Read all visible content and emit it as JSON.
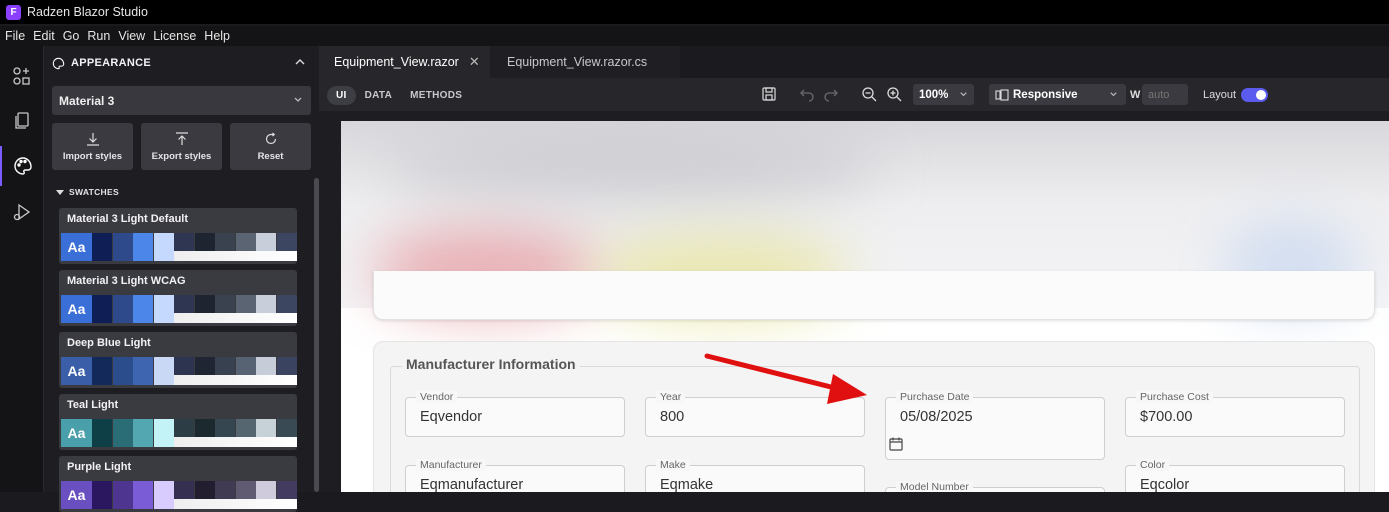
{
  "app": {
    "title": "Radzen Blazor Studio"
  },
  "menu": [
    "File",
    "Edit",
    "Go",
    "Run",
    "View",
    "License",
    "Help"
  ],
  "activity": [
    "components-icon",
    "files-icon",
    "palette-icon",
    "run-debug-icon"
  ],
  "panel": {
    "title": "APPEARANCE",
    "theme": "Material 3",
    "buttons": {
      "import": "Import styles",
      "export": "Export styles",
      "reset": "Reset"
    },
    "swatches_title": "SWATCHES",
    "swatches": [
      {
        "name": "Material 3 Light Default",
        "aa": "Aa",
        "aa_color": "#3b6fd8",
        "colors": [
          "#0f1f55",
          "#2e4a8a",
          "#4c86e8",
          "#c5d9ff",
          "#2f3652",
          "#1e2530",
          "#3a4250",
          "#5a6472",
          "#c8cfda",
          "#3c4660"
        ]
      },
      {
        "name": "Material 3 Light WCAG",
        "aa": "Aa",
        "aa_color": "#3b6fd8",
        "colors": [
          "#0f1f55",
          "#2e4a8a",
          "#4c86e8",
          "#c5d9ff",
          "#2f3652",
          "#1e2530",
          "#3a4250",
          "#5a6472",
          "#c8cfda",
          "#3c4660"
        ]
      },
      {
        "name": "Deep Blue Light",
        "aa": "Aa",
        "aa_color": "#3a5fa8",
        "colors": [
          "#12295a",
          "#2c4d8c",
          "#3e66b0",
          "#c9d8f5",
          "#2c3450",
          "#1f2532",
          "#384150",
          "#576272",
          "#c7cdd8",
          "#3a4460"
        ]
      },
      {
        "name": "Teal Light",
        "aa": "Aa",
        "aa_color": "#4aa0aa",
        "colors": [
          "#0e3f47",
          "#2a6d76",
          "#52a7b0",
          "#c3f2f7",
          "#2d3d45",
          "#1c2a30",
          "#364650",
          "#566670",
          "#c6d2d8",
          "#3a4a55"
        ]
      },
      {
        "name": "Purple Light",
        "aa": "Aa",
        "aa_color": "#6a4fc0",
        "colors": [
          "#2a1760",
          "#4d3590",
          "#7a5cd6",
          "#d8ccff",
          "#352f52",
          "#221e30",
          "#403a52",
          "#605a72",
          "#cfcbdc",
          "#443c60"
        ]
      }
    ]
  },
  "tabs": [
    {
      "label": "Equipment_View.razor",
      "active": true,
      "close": "✕"
    },
    {
      "label": "Equipment_View.razor.cs",
      "active": false
    }
  ],
  "toolbar": {
    "modes": [
      "UI",
      "DATA",
      "METHODS"
    ],
    "zoom": "100%",
    "device": "Responsive",
    "width_label": "W",
    "width_value": "auto",
    "layout_label": "Layout",
    "layout_on": true
  },
  "form": {
    "section_title": "Manufacturer Information",
    "fields": [
      {
        "label": "Vendor",
        "value": "Eqvendor"
      },
      {
        "label": "Year",
        "value": "800"
      },
      {
        "label": "Purchase Date",
        "value": "05/08/2025"
      },
      {
        "label": "Purchase Cost",
        "value": "$700.00"
      },
      {
        "label": "Manufacturer",
        "value": "Eqmanufacturer"
      },
      {
        "label": "Make",
        "value": "Eqmake"
      },
      {
        "label": "Model Number",
        "value": ""
      },
      {
        "label": "Color",
        "value": "Eqcolor"
      }
    ]
  },
  "colors": {
    "accent": "#7b5cff",
    "toggle": "#5b5bef",
    "annotation_arrow": "#e01010"
  }
}
